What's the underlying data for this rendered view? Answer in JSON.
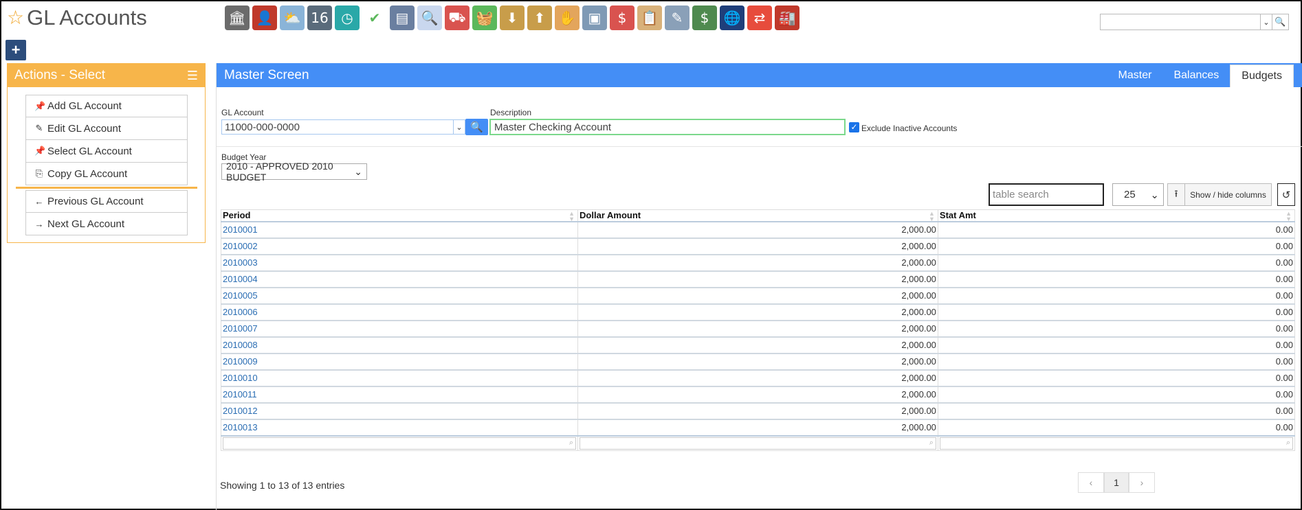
{
  "app": {
    "title": "GL Accounts"
  },
  "toolbar_icons": [
    {
      "name": "bank-icon",
      "bg": "#6b6b6b",
      "glyph": "🏛"
    },
    {
      "name": "user-icon",
      "bg": "#c0392b",
      "glyph": "👤"
    },
    {
      "name": "weather-icon",
      "bg": "#8ab4d8",
      "glyph": "⛅"
    },
    {
      "name": "calendar-icon",
      "bg": "#5a6b7b",
      "glyph": "16"
    },
    {
      "name": "clock-icon",
      "bg": "#2aa8a8",
      "glyph": "◷"
    },
    {
      "name": "checkmark-icon",
      "bg": "#ffffff",
      "glyph": "✔"
    },
    {
      "name": "keyboard-icon",
      "bg": "#6a7fa0",
      "glyph": "▤"
    },
    {
      "name": "magnifier-icon",
      "bg": "#c9d7ee",
      "glyph": "🔍"
    },
    {
      "name": "truck-icon",
      "bg": "#d9534f",
      "glyph": "⛟"
    },
    {
      "name": "basket-icon",
      "bg": "#5cb85c",
      "glyph": "🧺"
    },
    {
      "name": "inbox-download-icon",
      "bg": "#c89d4a",
      "glyph": "⬇"
    },
    {
      "name": "outbox-upload-icon",
      "bg": "#c89d4a",
      "glyph": "⬆"
    },
    {
      "name": "hand-cash-icon",
      "bg": "#e3a55c",
      "glyph": "✋"
    },
    {
      "name": "monitor-icon",
      "bg": "#7f9ab5",
      "glyph": "▣"
    },
    {
      "name": "dollar-bubble-icon",
      "bg": "#d9534f",
      "glyph": "$"
    },
    {
      "name": "clipboard-icon",
      "bg": "#d8b17a",
      "glyph": "📋"
    },
    {
      "name": "pencil-doc-icon",
      "bg": "#8aa0b8",
      "glyph": "✎"
    },
    {
      "name": "money-icon",
      "bg": "#4f8a4f",
      "glyph": "$"
    },
    {
      "name": "globe-book-icon",
      "bg": "#1f3f7a",
      "glyph": "🌐"
    },
    {
      "name": "refresh-arrows-icon",
      "bg": "#e74c3c",
      "glyph": "⇄"
    },
    {
      "name": "factory-icon",
      "bg": "#c0392b",
      "glyph": "🏭"
    }
  ],
  "actions": {
    "title": "Actions - Select",
    "items": [
      {
        "label": "Add GL Account",
        "icon": "📌"
      },
      {
        "label": "Edit GL Account",
        "icon": "✎"
      },
      {
        "label": "Select GL Account",
        "icon": "📌"
      },
      {
        "label": "Copy GL Account",
        "icon": "⎘"
      }
    ],
    "nav_items": [
      {
        "label": "Previous GL Account",
        "icon": "←"
      },
      {
        "label": "Next GL Account",
        "icon": "→"
      }
    ]
  },
  "main": {
    "title": "Master Screen",
    "tabs": [
      {
        "label": "Master"
      },
      {
        "label": "Balances"
      },
      {
        "label": "Budgets",
        "active": true
      }
    ],
    "gl_account_label": "GL Account",
    "gl_account_value": "11000-000-0000",
    "description_label": "Description",
    "description_value": "Master Checking Account",
    "exclude_inactive_label": "Exclude Inactive Accounts",
    "exclude_inactive_checked": true,
    "budget_year_label": "Budget Year",
    "budget_year_value": "2010 - APPROVED 2010 BUDGET"
  },
  "table": {
    "search_placeholder": "table search",
    "page_length": "25",
    "show_hide_label": "Show / hide columns",
    "columns": [
      "Period",
      "Dollar Amount",
      "Stat Amt"
    ],
    "rows": [
      [
        "2010001",
        "2,000.00",
        "0.00"
      ],
      [
        "2010002",
        "2,000.00",
        "0.00"
      ],
      [
        "2010003",
        "2,000.00",
        "0.00"
      ],
      [
        "2010004",
        "2,000.00",
        "0.00"
      ],
      [
        "2010005",
        "2,000.00",
        "0.00"
      ],
      [
        "2010006",
        "2,000.00",
        "0.00"
      ],
      [
        "2010007",
        "2,000.00",
        "0.00"
      ],
      [
        "2010008",
        "2,000.00",
        "0.00"
      ],
      [
        "2010009",
        "2,000.00",
        "0.00"
      ],
      [
        "2010010",
        "2,000.00",
        "0.00"
      ],
      [
        "2010011",
        "2,000.00",
        "0.00"
      ],
      [
        "2010012",
        "2,000.00",
        "0.00"
      ],
      [
        "2010013",
        "2,000.00",
        "0.00"
      ]
    ],
    "info": "Showing 1 to 13 of 13 entries",
    "pagination": {
      "prev": "‹",
      "current": "1",
      "next": "›"
    }
  }
}
